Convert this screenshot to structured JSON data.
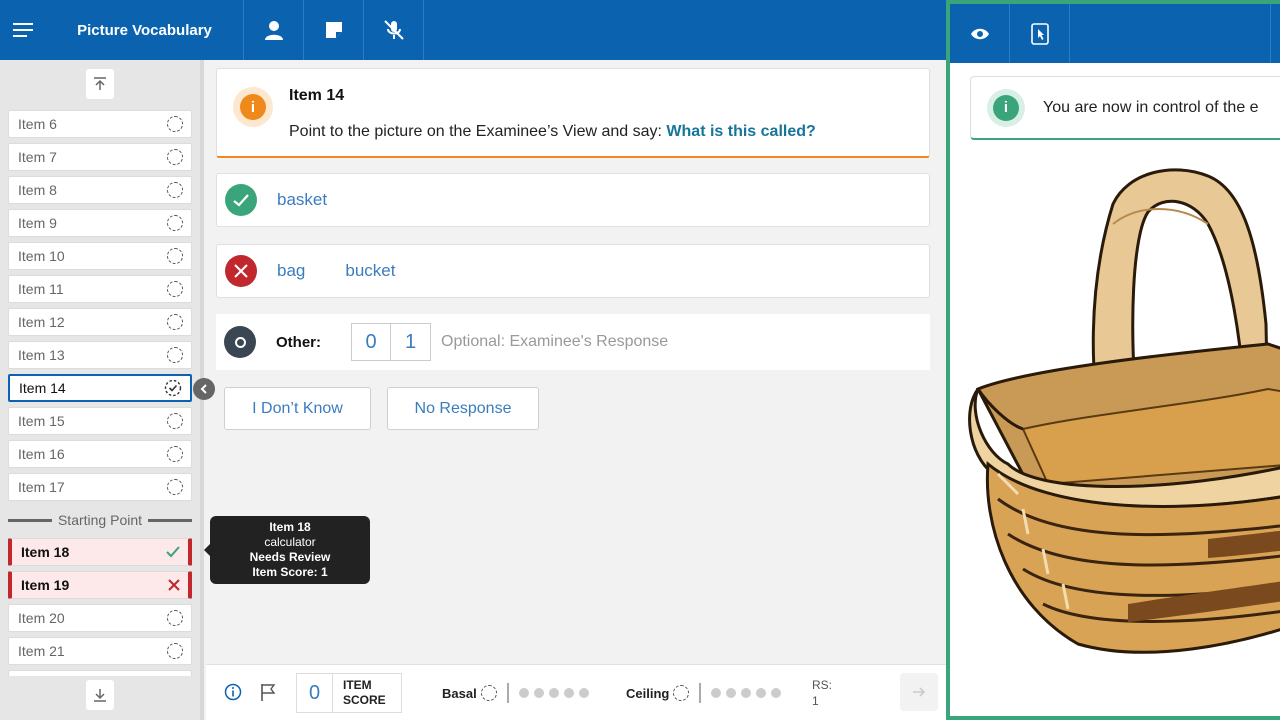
{
  "header": {
    "title": "Picture Vocabulary",
    "icons": [
      "menu-icon",
      "person-icon",
      "note-icon",
      "mic-off-icon"
    ]
  },
  "sidebar": {
    "items": [
      {
        "label": "Item 6",
        "state": "pending"
      },
      {
        "label": "Item 7",
        "state": "pending"
      },
      {
        "label": "Item 8",
        "state": "pending"
      },
      {
        "label": "Item 9",
        "state": "pending"
      },
      {
        "label": "Item 10",
        "state": "pending"
      },
      {
        "label": "Item 11",
        "state": "pending"
      },
      {
        "label": "Item 12",
        "state": "pending"
      },
      {
        "label": "Item 13",
        "state": "pending"
      },
      {
        "label": "Item 14",
        "state": "active"
      },
      {
        "label": "Item 15",
        "state": "pending"
      },
      {
        "label": "Item 16",
        "state": "pending"
      },
      {
        "label": "Item 17",
        "state": "pending"
      },
      {
        "label": "Item 18",
        "state": "correct"
      },
      {
        "label": "Item 19",
        "state": "incorrect"
      },
      {
        "label": "Item 20",
        "state": "pending"
      },
      {
        "label": "Item 21",
        "state": "pending"
      }
    ],
    "starting_point": "Starting Point"
  },
  "tooltip": {
    "title": "Item 18",
    "subtitle": "calculator",
    "status": "Needs Review",
    "score": "Item Score: 1"
  },
  "prompt": {
    "title": "Item 14",
    "text": "Point to the picture on the Examinee’s View and say: ",
    "question": "What is this called?"
  },
  "correct_responses": [
    "basket"
  ],
  "incorrect_responses": [
    "bag",
    "bucket"
  ],
  "other": {
    "label": "Other:",
    "score_options": [
      "0",
      "1"
    ],
    "placeholder": "Optional: Examinee's Response"
  },
  "buttons": {
    "dont_know": "I Don’t Know",
    "no_response": "No Response"
  },
  "bottom": {
    "item_score_value": "0",
    "item_score_label_1": "ITEM",
    "item_score_label_2": "SCORE",
    "basal_label": "Basal",
    "ceiling_label": "Ceiling",
    "rs_label": "RS:",
    "rs_value": "1"
  },
  "examinee_view": {
    "notice": "You are now in control of the e",
    "icons": [
      "eye-icon",
      "touch-screen-icon"
    ]
  },
  "colors": {
    "primary": "#0b63b0",
    "accent_orange": "#f0891b",
    "correct_green": "#3aa57a",
    "incorrect_red": "#c0282d"
  }
}
